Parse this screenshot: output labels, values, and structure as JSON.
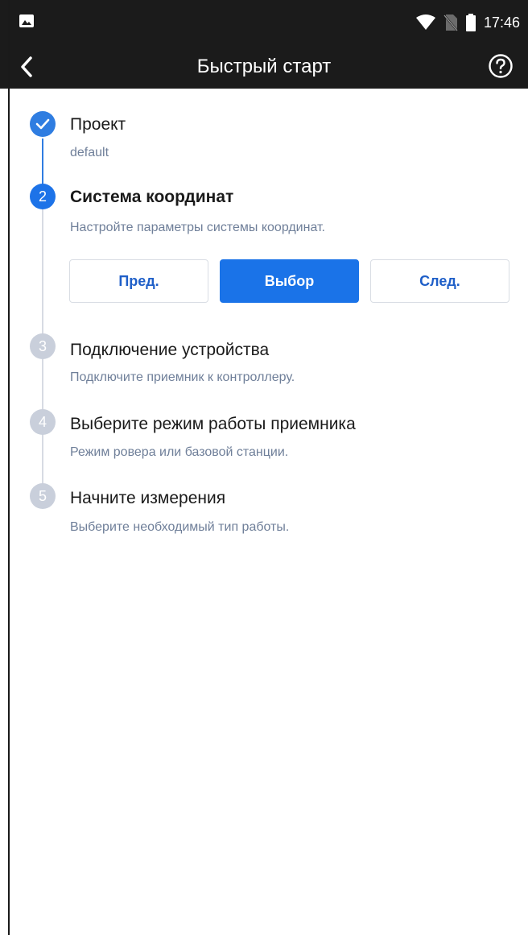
{
  "status_bar": {
    "time": "17:46"
  },
  "app_bar": {
    "title": "Быстрый старт"
  },
  "steps": [
    {
      "number": "1",
      "state": "done",
      "title": "Проект",
      "subtitle": "default"
    },
    {
      "number": "2",
      "state": "current",
      "title": "Система координат",
      "subtitle": "Настройте параметры системы координат."
    },
    {
      "number": "3",
      "state": "pending",
      "title": "Подключение устройства",
      "subtitle": "Подключите приемник к контроллеру."
    },
    {
      "number": "4",
      "state": "pending",
      "title": "Выберите режим работы приемника",
      "subtitle": "Режим ровера или базовой станции."
    },
    {
      "number": "5",
      "state": "pending",
      "title": "Начните измерения",
      "subtitle": "Выберите необходимый тип работы."
    }
  ],
  "actions": {
    "prev_label": "Пред.",
    "select_label": "Выбор",
    "next_label": "След."
  },
  "colors": {
    "accent": "#1a73e8",
    "bar": "#1b1b1b",
    "pending": "#c9cfdb",
    "subtitle": "#6f7f99"
  }
}
